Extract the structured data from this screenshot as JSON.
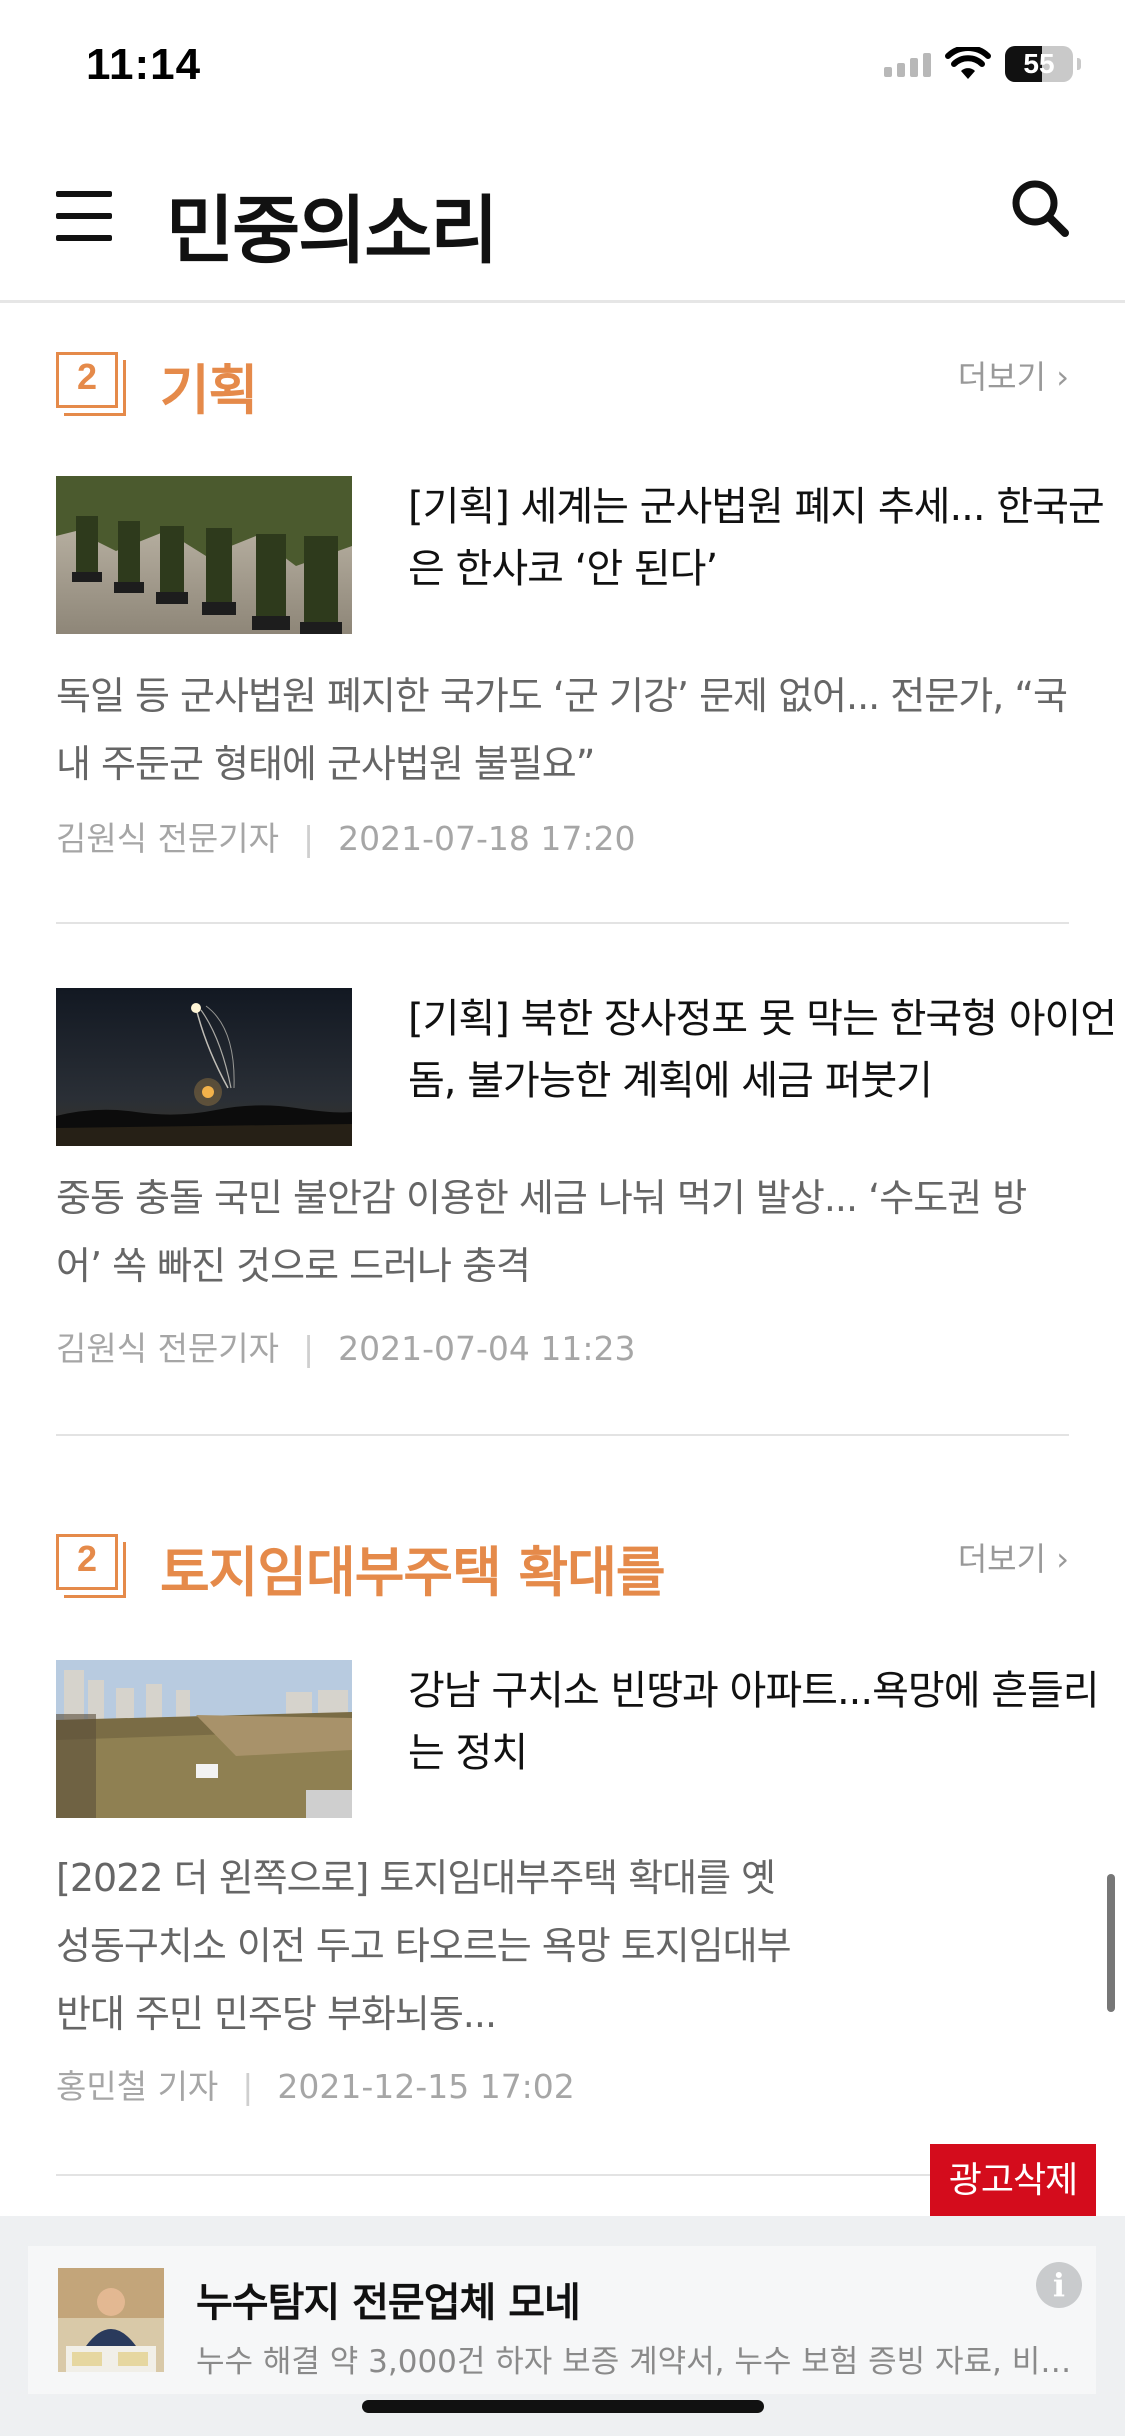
{
  "status_bar": {
    "time": "11:14",
    "battery": "55",
    "battery_level": 0.55
  },
  "header": {
    "logo": "민중의소리"
  },
  "sections": [
    {
      "rank": "2",
      "title": "기획",
      "more": "더보기 ›",
      "articles": [
        {
          "headline": "[기획] 세계는 군사법원 폐지 추세... 한국군은 한사코 ‘안 된다’",
          "summary": "독일 등 군사법원 폐지한 국가도 ‘군 기강’ 문제 없어... 전문가, “국내 주둔군 형태에 군사법원 불필요”",
          "author": "김원식 전문기자",
          "date": "2021-07-18 17:20"
        },
        {
          "headline": "[기획] 북한 장사정포 못 막는 한국형 아이언돔, 불가능한 계획에 세금 퍼붓기",
          "summary": "중동 충돌 국민 불안감 이용한 세금 나눠 먹기 발상... ‘수도권 방어’ 쏙 빠진 것으로 드러나 충격",
          "author": "김원식 전문기자",
          "date": "2021-07-04 11:23"
        }
      ]
    },
    {
      "rank": "2",
      "title": "토지임대부주택 확대를",
      "more": "더보기 ›",
      "articles": [
        {
          "headline": "강남 구치소 빈땅과 아파트...욕망에 흔들리는 정치",
          "summary": "[2022 더 왼쪽으로] 토지임대부주택 확대를 옛 성동구치소 이전 두고 타오르는 욕망 토지임대부 반대 주민 민주당 부화뇌동...",
          "author": "홍민철 기자",
          "date": "2021-12-15 17:02"
        }
      ]
    }
  ],
  "ad": {
    "remove_label": "광고삭제",
    "title": "누수탐지 전문업체 모네",
    "description": "누수 해결 약 3,000건 하자 보증 계약서, 누수 보험 증빙 자료, 비…",
    "info_icon": "i"
  },
  "colors": {
    "accent": "#e58a4a",
    "ad_remove": "#d40c1c"
  }
}
